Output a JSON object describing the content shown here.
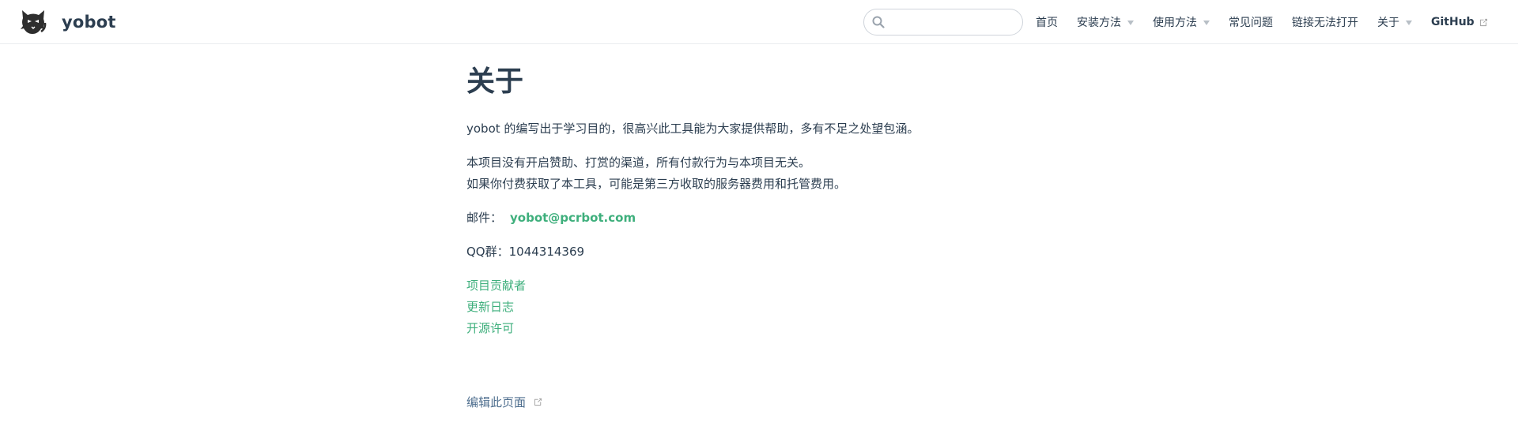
{
  "navbar": {
    "site_name": "yobot",
    "logo_icon": "cat-logo-icon",
    "search": {
      "placeholder": "",
      "value": ""
    },
    "items": [
      {
        "label": "首页",
        "dropdown": false
      },
      {
        "label": "安装方法",
        "dropdown": true
      },
      {
        "label": "使用方法",
        "dropdown": true
      },
      {
        "label": "常见问题",
        "dropdown": false
      },
      {
        "label": "链接无法打开",
        "dropdown": false
      },
      {
        "label": "关于",
        "dropdown": true
      },
      {
        "label": "GitHub",
        "dropdown": false,
        "external": true
      }
    ]
  },
  "page": {
    "title": "关于",
    "intro": "yobot 的编写出于学习目的，很高兴此工具能为大家提供帮助，多有不足之处望包涵。",
    "notice_line1": "本项目没有开启赞助、打赏的渠道，所有付款行为与本项目无关。",
    "notice_line2": "如果你付费获取了本工具，可能是第三方收取的服务器费用和托管费用。",
    "email_label": "邮件：",
    "email": "yobot@pcrbot.com",
    "qq_group": "QQ群：1044314369",
    "links": [
      "项目贡献者",
      "更新日志",
      "开源许可"
    ],
    "edit_link": "编辑此页面"
  },
  "colors": {
    "accent": "#3eaf7c",
    "text": "#2c3e50",
    "border": "#eaecef"
  }
}
